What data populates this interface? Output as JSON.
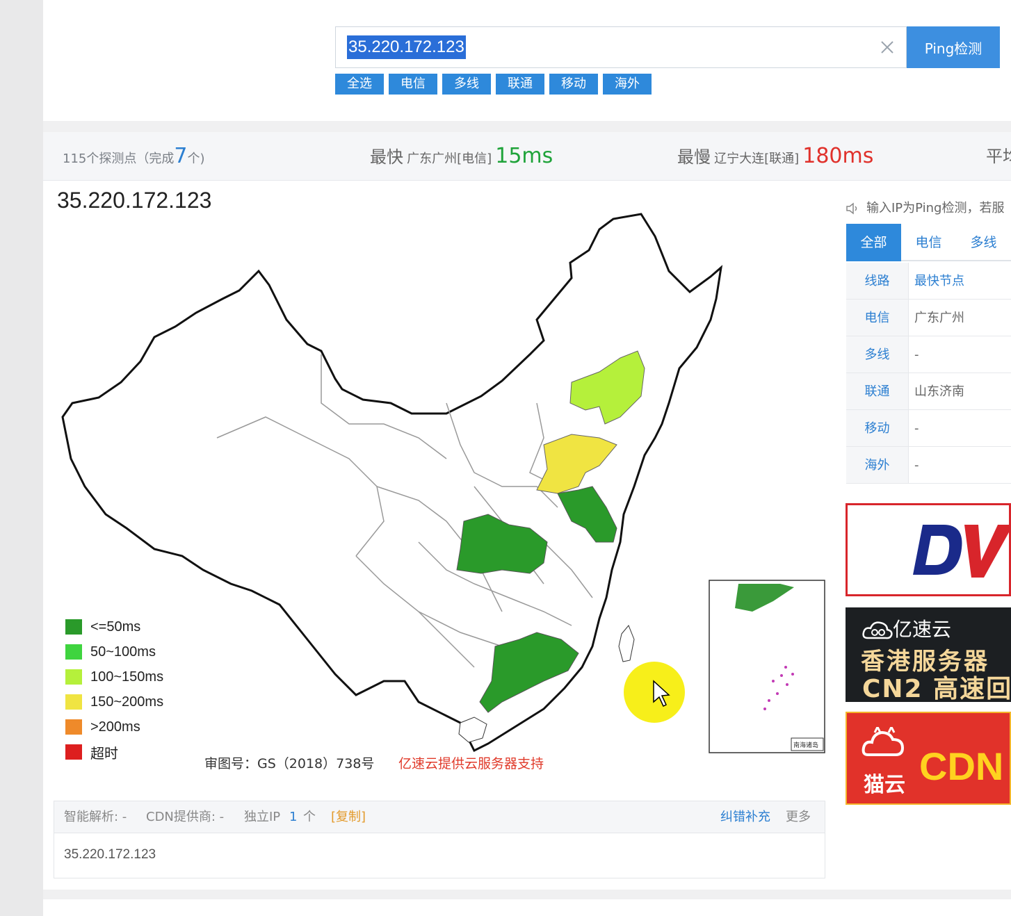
{
  "search": {
    "value": "35.220.172.123",
    "button_label": "Ping检测"
  },
  "filters": [
    "全选",
    "电信",
    "多线",
    "联通",
    "移动",
    "海外"
  ],
  "stats": {
    "probes": "115个探测点（完成",
    "done": "7",
    "done_suffix": "个)",
    "fastest_label": "最快",
    "fastest_location": "广东广州[电信]",
    "fastest_value": "15ms",
    "slowest_label": "最慢",
    "slowest_location": "辽宁大连[联通]",
    "slowest_value": "180ms",
    "avg_label": "平均"
  },
  "map": {
    "title": "35.220.172.123",
    "legend": [
      {
        "color": "#2a9a2a",
        "label": "<=50ms"
      },
      {
        "color": "#3fd43f",
        "label": "50~100ms"
      },
      {
        "color": "#b5f03b",
        "label": "100~150ms"
      },
      {
        "color": "#f0e442",
        "label": "150~200ms"
      },
      {
        "color": "#ef8a2a",
        "label": ">200ms"
      },
      {
        "color": "#dd1f1f",
        "label": "超时"
      }
    ],
    "approval": "审图号：GS（2018）738号",
    "sponsor": "亿速云提供云服务器支持",
    "inset_label": "南海诸岛"
  },
  "info": {
    "smart_resolve": "智能解析: -",
    "cdn_provider": "CDN提供商: -",
    "unique_ip_label": "独立IP",
    "unique_ip_count": "1",
    "unique_ip_unit": "个",
    "copy": "[复制]",
    "correction": "纠错补充",
    "more": "更多",
    "ip_list": "35.220.172.123"
  },
  "sidebar": {
    "notice": "输入IP为Ping检测，若服",
    "tabs": [
      "全部",
      "电信",
      "多线"
    ],
    "table_header": [
      "线路",
      "最快节点"
    ],
    "rows": [
      {
        "line": "电信",
        "node": "广东广州"
      },
      {
        "line": "多线",
        "node": "-"
      },
      {
        "line": "联通",
        "node": "山东济南"
      },
      {
        "line": "移动",
        "node": "-"
      },
      {
        "line": "海外",
        "node": "-"
      }
    ],
    "ads": {
      "yisu_brand": "亿速云",
      "yisu_line1": "香港服务器",
      "yisu_line2": "CN2 高速回",
      "maoyun_brand": "猫云",
      "maoyun_text": "CDN"
    }
  }
}
